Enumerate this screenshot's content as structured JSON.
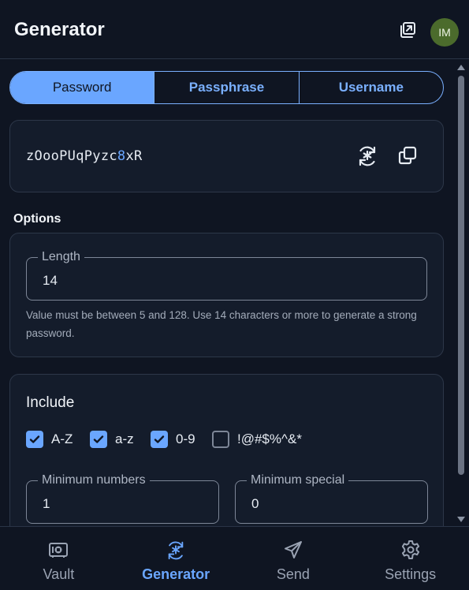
{
  "header": {
    "title": "Generator",
    "avatar_initials": "IM"
  },
  "tabs": [
    {
      "label": "Password",
      "active": true
    },
    {
      "label": "Passphrase",
      "active": false
    },
    {
      "label": "Username",
      "active": false
    }
  ],
  "password": {
    "segments": [
      {
        "text": "zOooPUqPyzc",
        "numeric": false
      },
      {
        "text": "8",
        "numeric": true
      },
      {
        "text": "xR",
        "numeric": false
      }
    ]
  },
  "options": {
    "section_label": "Options",
    "length_label": "Length",
    "length_value": "14",
    "length_hint": "Value must be between 5 and 128. Use 14 characters or more to generate a strong password."
  },
  "include": {
    "title": "Include",
    "checkboxes": [
      {
        "label": "A-Z",
        "checked": true
      },
      {
        "label": "a-z",
        "checked": true
      },
      {
        "label": "0-9",
        "checked": true
      },
      {
        "label": "!@#$%^&*",
        "checked": false
      }
    ],
    "min_numbers_label": "Minimum numbers",
    "min_numbers_value": "1",
    "min_special_label": "Minimum special",
    "min_special_value": "0"
  },
  "nav": {
    "items": [
      {
        "label": "Vault",
        "icon": "vault-icon",
        "active": false
      },
      {
        "label": "Generator",
        "icon": "generator-icon",
        "active": true
      },
      {
        "label": "Send",
        "icon": "send-icon",
        "active": false
      },
      {
        "label": "Settings",
        "icon": "settings-icon",
        "active": false
      }
    ]
  },
  "colors": {
    "accent": "#6aa6ff",
    "background": "#0f1522",
    "card": "#141c2b",
    "avatar": "#4b6b2c"
  }
}
